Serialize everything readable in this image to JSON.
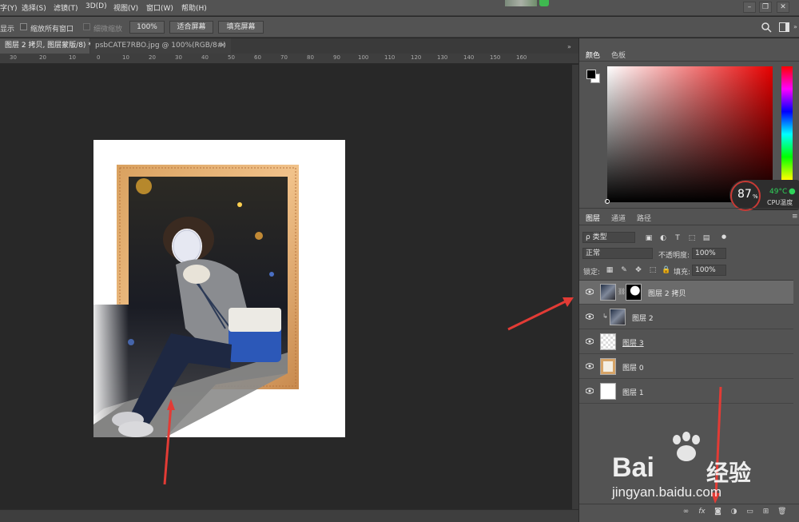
{
  "menu": [
    "字(Y)",
    "选择(S)",
    "滤镜(T)",
    "3D(D)",
    "视图(V)",
    "窗口(W)",
    "帮助(H)"
  ],
  "options": {
    "show_label": "显示",
    "zoom_all_windows": "缩放所有窗口",
    "scrubby_zoom": "细微缩放",
    "zoom_value": "100%",
    "fit_screen": "适合屏幕",
    "fill_screen": "填充屏幕"
  },
  "tabs": {
    "active": "图层 2 拷贝, 图层蒙版/8) *",
    "inactive": "psbCATE7RBO.jpg @ 100%(RGB/8#)",
    "close": "×"
  },
  "ruler": [
    "30",
    "20",
    "10",
    "0",
    "10",
    "20",
    "30",
    "40",
    "50",
    "60",
    "70",
    "80",
    "90",
    "100",
    "110",
    "120",
    "130",
    "140",
    "150",
    "160"
  ],
  "color_panel": {
    "tab_color": "颜色",
    "tab_swatches": "色板"
  },
  "cpu": {
    "percent": "87",
    "percent_sign": "%",
    "temp": "49°C",
    "label": "CPU温度"
  },
  "layers_panel": {
    "tab_layers": "图层",
    "tab_channels": "通道",
    "tab_paths": "路径",
    "filter_kind": "ρ 类型",
    "blend_mode": "正常",
    "opacity_label": "不透明度:",
    "opacity_value": "100%",
    "lock_label": "锁定:",
    "fill_label": "填充:",
    "fill_value": "100%",
    "layers": [
      {
        "name": "图层 2 拷贝",
        "selected": true
      },
      {
        "name": "图层 2",
        "selected": false
      },
      {
        "name": "图层 3",
        "selected": false
      },
      {
        "name": "图层 0",
        "selected": false
      },
      {
        "name": "图层 1",
        "selected": false
      }
    ],
    "footer_fx": "fx"
  },
  "watermark": {
    "brand_prefix": "Bai",
    "brand_suffix": "经验",
    "url": "jingyan.baidu.com"
  },
  "colors": {
    "arrow": "#e23b35",
    "cpu_green": "#2fd35a",
    "selected_layer": "#6b6b6b"
  }
}
